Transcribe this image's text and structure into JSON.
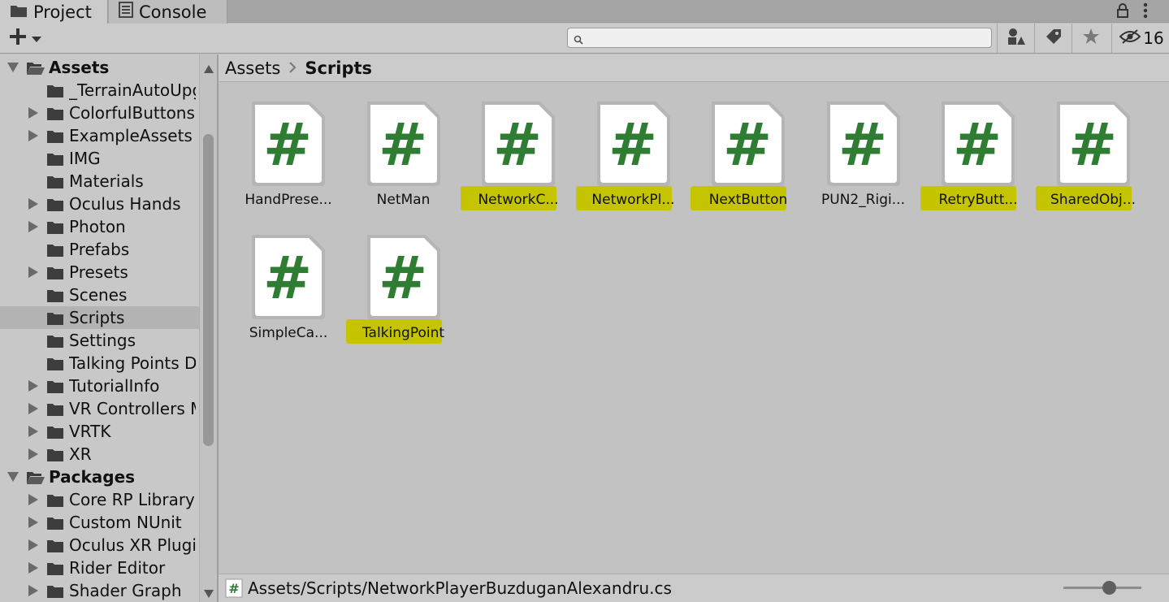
{
  "tabs": [
    {
      "label": "Project",
      "icon": "folder-icon",
      "active": true
    },
    {
      "label": "Console",
      "icon": "console-icon",
      "active": false
    }
  ],
  "toolbar": {
    "search_placeholder": "",
    "hidden_count": "16"
  },
  "tree": {
    "items": [
      {
        "label": "Assets",
        "level": 0,
        "expanded": true,
        "bold": true,
        "has_arrow": true
      },
      {
        "label": "_TerrainAutoUpgrade",
        "level": 1,
        "has_arrow": false
      },
      {
        "label": "ColorfulButtons",
        "level": 1,
        "has_arrow": true
      },
      {
        "label": "ExampleAssets",
        "level": 1,
        "has_arrow": true
      },
      {
        "label": "IMG",
        "level": 1,
        "has_arrow": false
      },
      {
        "label": "Materials",
        "level": 1,
        "has_arrow": false
      },
      {
        "label": "Oculus Hands",
        "level": 1,
        "has_arrow": true
      },
      {
        "label": "Photon",
        "level": 1,
        "has_arrow": true
      },
      {
        "label": "Prefabs",
        "level": 1,
        "has_arrow": false
      },
      {
        "label": "Presets",
        "level": 1,
        "has_arrow": true
      },
      {
        "label": "Scenes",
        "level": 1,
        "has_arrow": false
      },
      {
        "label": "Scripts",
        "level": 1,
        "has_arrow": false,
        "selected": true
      },
      {
        "label": "Settings",
        "level": 1,
        "has_arrow": false
      },
      {
        "label": "Talking Points D",
        "level": 1,
        "has_arrow": false
      },
      {
        "label": "TutorialInfo",
        "level": 1,
        "has_arrow": true
      },
      {
        "label": "VR Controllers M",
        "level": 1,
        "has_arrow": true
      },
      {
        "label": "VRTK",
        "level": 1,
        "has_arrow": true
      },
      {
        "label": "XR",
        "level": 1,
        "has_arrow": true
      },
      {
        "label": "Packages",
        "level": 0,
        "expanded": true,
        "bold": true,
        "has_arrow": true
      },
      {
        "label": "Core RP Library",
        "level": 1,
        "has_arrow": true
      },
      {
        "label": "Custom NUnit",
        "level": 1,
        "has_arrow": true
      },
      {
        "label": "Oculus XR Plugi",
        "level": 1,
        "has_arrow": true
      },
      {
        "label": "Rider Editor",
        "level": 1,
        "has_arrow": true
      },
      {
        "label": "Shader Graph",
        "level": 1,
        "has_arrow": true
      }
    ]
  },
  "breadcrumb": {
    "root": "Assets",
    "current": "Scripts"
  },
  "files": [
    {
      "name": "HandPrese...",
      "highlighted": false
    },
    {
      "name": "NetMan",
      "highlighted": false
    },
    {
      "name": "NetworkC...",
      "highlighted": true
    },
    {
      "name": "NetworkPl...",
      "highlighted": true
    },
    {
      "name": "NextButton",
      "highlighted": true
    },
    {
      "name": "PUN2_Rigi...",
      "highlighted": false
    },
    {
      "name": "RetryButt...",
      "highlighted": true
    },
    {
      "name": "SharedObj...",
      "highlighted": true
    },
    {
      "name": "SimpleCa...",
      "highlighted": false
    },
    {
      "name": "TalkingPoint",
      "highlighted": true
    }
  ],
  "footer": {
    "path": "Assets/Scripts/NetworkPlayerBuzduganAlexandru.cs",
    "zoom": 0.5
  },
  "colors": {
    "script_hash": "#2e7d32",
    "highlight": "#c5c400"
  }
}
